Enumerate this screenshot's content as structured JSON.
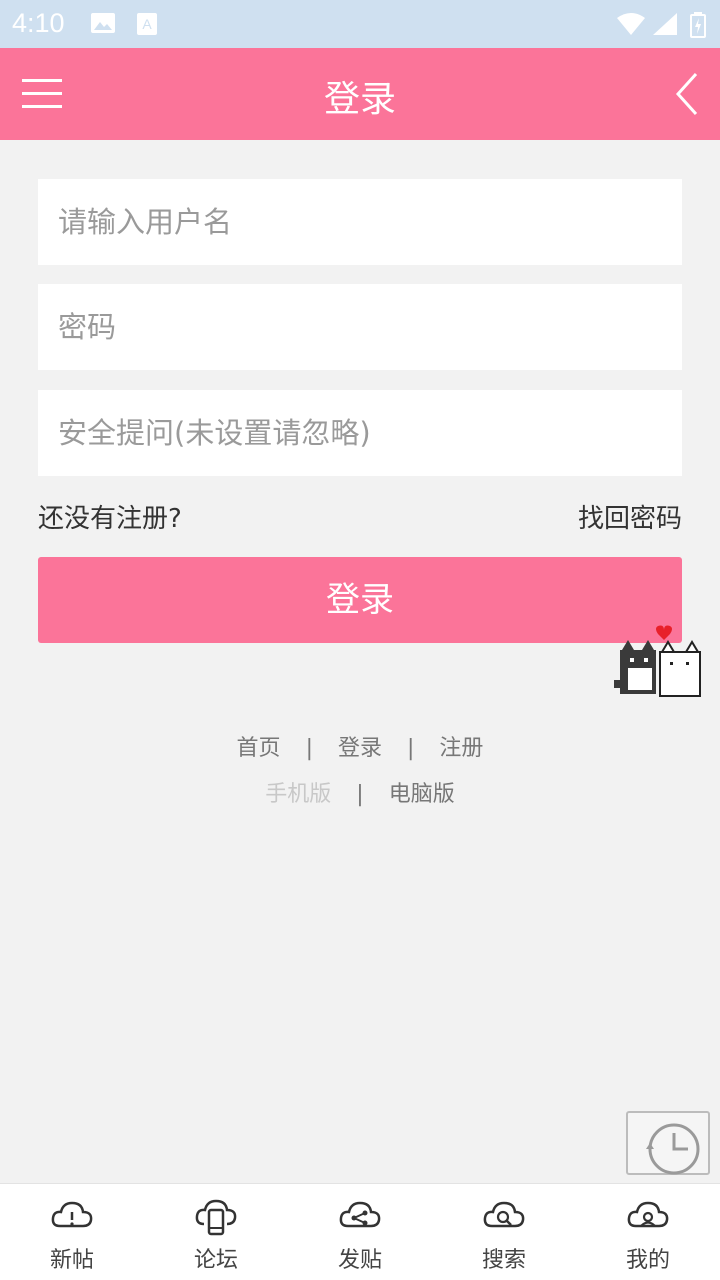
{
  "status_bar": {
    "time": "4:10"
  },
  "header": {
    "title": "登录",
    "menu_icon": "hamburger-menu-icon",
    "back_icon": "chevron-left-icon"
  },
  "form": {
    "username_placeholder": "请输入用户名",
    "password_placeholder": "密码",
    "security_placeholder": "安全提问(未设置请忽略)"
  },
  "links": {
    "register": "还没有注册?",
    "forgot": "找回密码"
  },
  "login_button": "登录",
  "footer": {
    "row1": [
      "首页",
      "登录",
      "注册"
    ],
    "separator": "|",
    "row2": [
      "手机版",
      "电脑版"
    ]
  },
  "tabbar": {
    "items": [
      {
        "label": "新帖"
      },
      {
        "label": "论坛"
      },
      {
        "label": "发贴"
      },
      {
        "label": "搜索"
      },
      {
        "label": "我的"
      }
    ]
  },
  "colors": {
    "brand": "#fb7499",
    "background": "#f2f2f2"
  }
}
